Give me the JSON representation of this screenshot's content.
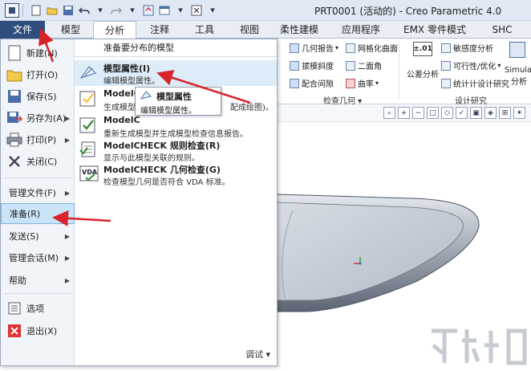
{
  "window": {
    "title": "PRT0001 (活动的) - Creo Parametric 4.0"
  },
  "tabs": [
    {
      "label": "文件"
    },
    {
      "label": "模型"
    },
    {
      "label": "分析"
    },
    {
      "label": "注释"
    },
    {
      "label": "工具"
    },
    {
      "label": "视图"
    },
    {
      "label": "柔性建模"
    },
    {
      "label": "应用程序"
    },
    {
      "label": "EMX 零件模式"
    },
    {
      "label": "SHC"
    }
  ],
  "ribbon": {
    "items": {
      "geom_report": "几何报告",
      "mesh_surface": "网格化曲面",
      "sensitivity": "敏感度分析",
      "draft": "拔模斜度",
      "dihedral": "二面角",
      "feasibility": "可行性/优化",
      "clearance": "配合间隙",
      "curvature": "曲率",
      "tolerance_label": "公差分析",
      "statistical": "统计计设计研究",
      "simulate": "Simulat",
      "simulate_2": "分析",
      "tol_badge": "±.01"
    },
    "groups": {
      "inspect": "检查几何",
      "design_study": "设计研究"
    }
  },
  "menu": {
    "left": [
      {
        "label": "新建(N)"
      },
      {
        "label": "打开(O)"
      },
      {
        "label": "保存(S)"
      },
      {
        "label": "另存为(A)"
      },
      {
        "label": "打印(P)"
      },
      {
        "label": "关闭(C)"
      },
      {
        "label": "管理文件(F)"
      },
      {
        "label": "准备(R)"
      },
      {
        "label": "发送(S)"
      },
      {
        "label": "管理会话(M)"
      },
      {
        "label": "帮助"
      },
      {
        "label": "选项"
      },
      {
        "label": "退出(X)"
      }
    ],
    "right": {
      "header": "准备要分布的模型",
      "items": [
        {
          "title": "模型属性(I)",
          "desc": "编辑模型属性。"
        },
        {
          "title": "ModelC",
          "desc": "生成模型",
          "desc_tail": "配成绘图)。"
        },
        {
          "title": "ModelC",
          "desc": "重新生成模型并生成模型检查信息报告。"
        },
        {
          "title": "ModelCHECK 规则检查(R)",
          "desc": "显示与此模型关联的规则。"
        },
        {
          "title": "ModelCHECK 几何检查(G)",
          "desc": "检查模型几何是否符合 VDA 标准。"
        }
      ],
      "debug": "调试"
    }
  },
  "tooltip": {
    "title": "模型属性",
    "desc": "编辑模型属性。"
  },
  "icons": {
    "vda_text": "VDA"
  }
}
